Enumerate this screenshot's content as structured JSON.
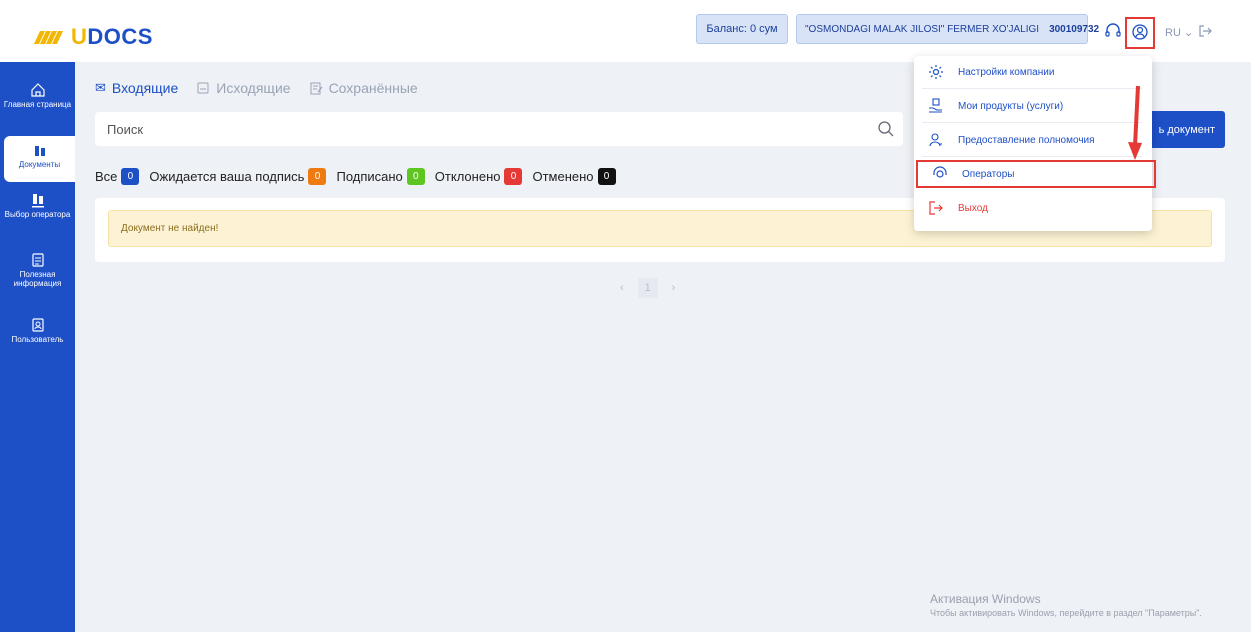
{
  "app": {
    "logo": "UDOCS",
    "balance": "Баланс: 0 сум",
    "company_name": "\"OSMONDAGI MALAK JILOSI\" FERMER XO'JALIGI",
    "company_inn": "300109732",
    "language": "RU"
  },
  "sidebar": {
    "items": [
      {
        "label": "Главная страница",
        "icon": "home-icon"
      },
      {
        "label": "Документы",
        "icon": "documents-icon"
      },
      {
        "label": "Выбор оператора",
        "icon": "operator-icon"
      },
      {
        "label": "Полезная информация",
        "icon": "info-icon"
      },
      {
        "label": "Пользователь",
        "icon": "user-icon"
      }
    ]
  },
  "tabs": [
    {
      "label": "Входящие",
      "icon": "envelope-icon"
    },
    {
      "label": "Исходящие",
      "icon": "outbox-icon"
    },
    {
      "label": "Сохранённые",
      "icon": "draft-icon"
    }
  ],
  "search": {
    "placeholder": "Поиск"
  },
  "new_document_button": "ь документ",
  "filters": [
    {
      "label": "Все",
      "count": "0",
      "color": "#1d4fc7"
    },
    {
      "label": "Ожидается ваша подпись",
      "count": "0",
      "color": "#f07a12"
    },
    {
      "label": "Подписано",
      "count": "0",
      "color": "#5fc520"
    },
    {
      "label": "Отклонено",
      "count": "0",
      "color": "#e53935"
    },
    {
      "label": "Отменено",
      "count": "0",
      "color": "#111111"
    }
  ],
  "alert": "Документ не найден!",
  "pagination": {
    "prev": "‹",
    "page": "1",
    "next": "›"
  },
  "dropdown": {
    "items": [
      {
        "label": "Настройки компании",
        "icon": "gear-icon"
      },
      {
        "label": "Мои продукты (услуги)",
        "icon": "products-icon"
      },
      {
        "label": "Предоставление полномочия",
        "icon": "delegation-icon"
      },
      {
        "label": "Операторы",
        "icon": "operators-icon"
      },
      {
        "label": "Выход",
        "icon": "logout-icon",
        "color": "#e53935"
      }
    ]
  },
  "watermark": {
    "line1": "Активация Windows",
    "line2": "Чтобы активировать Windows, перейдите в раздел \"Параметры\"."
  },
  "colors": {
    "brand": "#1d4fc7",
    "accent": "#f2b705",
    "highlight": "#e53935"
  }
}
